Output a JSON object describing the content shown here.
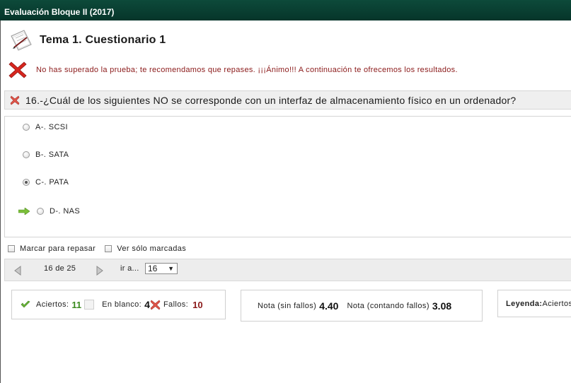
{
  "window": {
    "title": "Evaluación Bloque II (2017)"
  },
  "header": {
    "title": "Tema 1. Cuestionario 1",
    "icon": "document-pencil-icon"
  },
  "result": {
    "message": "No has superado la prueba; te recomendamos que repases. ¡¡¡Ánimo!!! A continuación te ofrecemos los resultados.",
    "icon": "red-x-icon"
  },
  "question": {
    "text": "16.-¿Cuál de los siguientes NO se corresponde con un interfaz de almacenamiento físico en un ordenador?",
    "status_icon": "wrong-x-icon",
    "options": [
      {
        "label": "A-. SCSI",
        "selected": false,
        "correct": false
      },
      {
        "label": "B-. SATA",
        "selected": false,
        "correct": false
      },
      {
        "label": "C-. PATA",
        "selected": true,
        "correct": false
      },
      {
        "label": "D-. NAS",
        "selected": false,
        "correct": true
      }
    ]
  },
  "review": {
    "mark_label": "Marcar para repasar",
    "only_marked_label": "Ver sólo marcadas"
  },
  "navigation": {
    "counter": "16 de 25",
    "goto_label": "ir a...",
    "goto_value": "16"
  },
  "summary": {
    "aciertos_label": "Aciertos:",
    "aciertos": "11",
    "blanco_label": "En blanco:",
    "blanco": "4",
    "fallos_label": "Fallos:",
    "fallos": "10"
  },
  "grades": {
    "sin_fallos_label": "Nota (sin fallos)",
    "sin_fallos": "4.40",
    "contando_fallos_label": "Nota (contando fallos)",
    "contando_fallos": "3.08"
  },
  "legend": {
    "label": "Leyenda:",
    "first": "Aciertos"
  },
  "colors": {
    "titlebar": "#06352a",
    "error": "#8b1a1a",
    "success": "#3a8a1e"
  }
}
